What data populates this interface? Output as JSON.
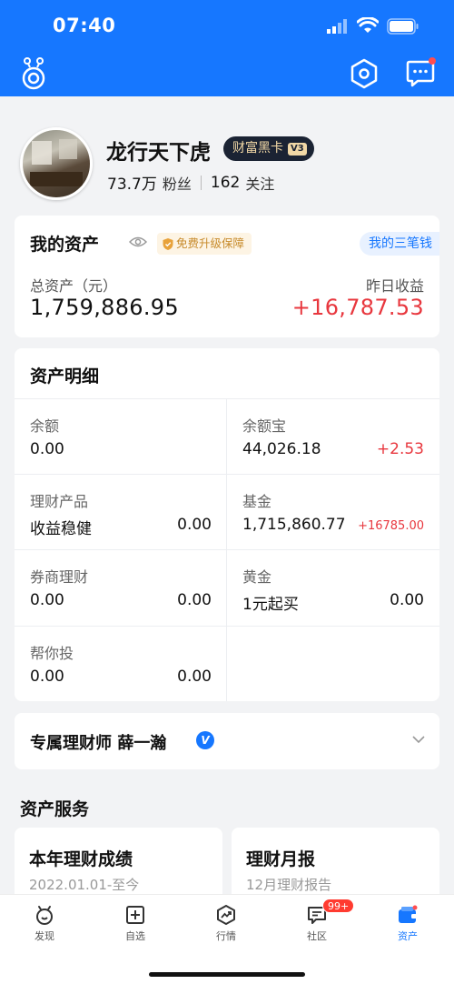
{
  "status_bar": {
    "time": "07:40"
  },
  "profile": {
    "nickname": "龙行天下虎",
    "badge": "财富黑卡",
    "badge_level": "V3",
    "fans": "73.7万",
    "fans_label": "粉丝",
    "following": "162",
    "following_label": "关注"
  },
  "assets": {
    "title": "我的资产",
    "upgrade_label": "免费升级保障",
    "three_label": "我的三笔钱",
    "total_label": "总资产（元）",
    "total_value": "1,759,886.95",
    "yesterday_label": "昨日收益",
    "yesterday_value": "+16,787.53"
  },
  "detail": {
    "title": "资产明细",
    "cells": [
      {
        "name": "余额",
        "sub": "0.00",
        "value": ""
      },
      {
        "name": "余额宝",
        "sub": "44,026.18",
        "value": "+2.53"
      },
      {
        "name": "理财产品",
        "sub": "收益稳健",
        "value": "0.00"
      },
      {
        "name": "基金",
        "sub": "1,715,860.77",
        "value": "+16785.00"
      },
      {
        "name": "券商理财",
        "sub": "0.00",
        "value": "0.00"
      },
      {
        "name": "黄金",
        "sub": "1元起买",
        "value": "0.00"
      },
      {
        "name": "帮你投",
        "sub": "0.00",
        "value": "0.00"
      }
    ]
  },
  "advisor": {
    "text": "专属理财师 薛一瀚",
    "verified": "V"
  },
  "services": {
    "title": "资产服务",
    "items": [
      {
        "name": "本年理财成绩",
        "sub": "2022.01.01-至今"
      },
      {
        "name": "理财月报",
        "sub": "12月理财报告"
      }
    ]
  },
  "tabbar": {
    "items": [
      {
        "label": "发现",
        "icon": "discover-icon"
      },
      {
        "label": "自选",
        "icon": "watchlist-icon"
      },
      {
        "label": "行情",
        "icon": "market-icon"
      },
      {
        "label": "社区",
        "icon": "community-icon",
        "badge": "99+"
      },
      {
        "label": "资产",
        "icon": "wallet-icon"
      }
    ],
    "active": "资产"
  },
  "colors": {
    "brand": "#1677ff",
    "gain": "#e8373e",
    "gold": "#c78a2a"
  }
}
